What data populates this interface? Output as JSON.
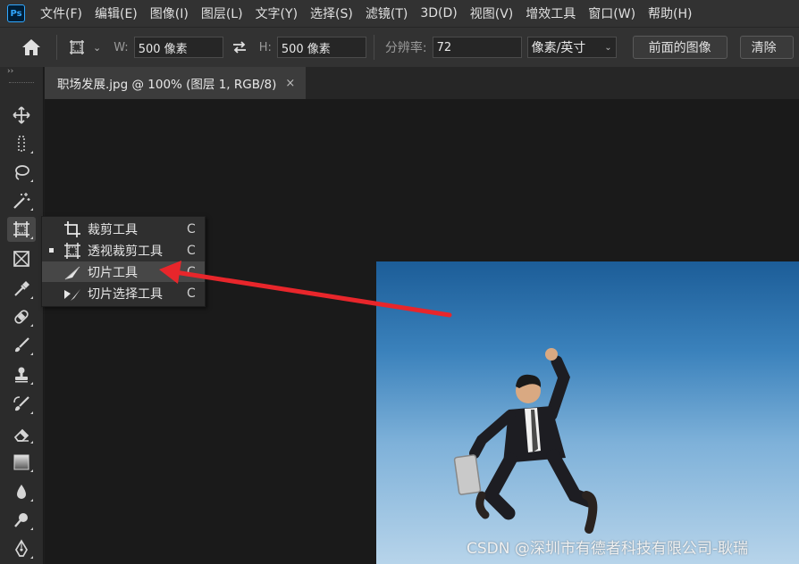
{
  "app": {
    "logo_text": "Ps"
  },
  "menu": [
    "文件(F)",
    "编辑(E)",
    "图像(I)",
    "图层(L)",
    "文字(Y)",
    "选择(S)",
    "滤镜(T)",
    "3D(D)",
    "视图(V)",
    "增效工具",
    "窗口(W)",
    "帮助(H)"
  ],
  "options": {
    "width_label": "W:",
    "width_value": "500 像素",
    "height_label": "H:",
    "height_value": "500 像素",
    "resolution_label": "分辨率:",
    "resolution_value": "72",
    "unit_value": "像素/英寸",
    "front_image_label": "前面的图像",
    "clear_label": "清除"
  },
  "document_tab": {
    "title": "职场发展.jpg @ 100% (图层 1, RGB/8)",
    "close_glyph": "×"
  },
  "toolbar": {
    "collapse_glyph": "››"
  },
  "flyout": [
    {
      "label": "裁剪工具",
      "key": "C",
      "icon": "crop-icon",
      "selected": false,
      "highlighted": false
    },
    {
      "label": "透视裁剪工具",
      "key": "C",
      "icon": "perspective-crop-icon",
      "selected": true,
      "highlighted": false
    },
    {
      "label": "切片工具",
      "key": "C",
      "icon": "slice-icon",
      "selected": false,
      "highlighted": true
    },
    {
      "label": "切片选择工具",
      "key": "C",
      "icon": "slice-select-icon",
      "selected": false,
      "highlighted": false
    }
  ],
  "watermark": "CSDN @深圳市有德者科技有限公司-耿瑞",
  "colors": {
    "arrow": "#e8262b",
    "accent": "#31a8ff",
    "sky_top": "#1c5d98",
    "sky_bottom": "#b7d4ea"
  }
}
